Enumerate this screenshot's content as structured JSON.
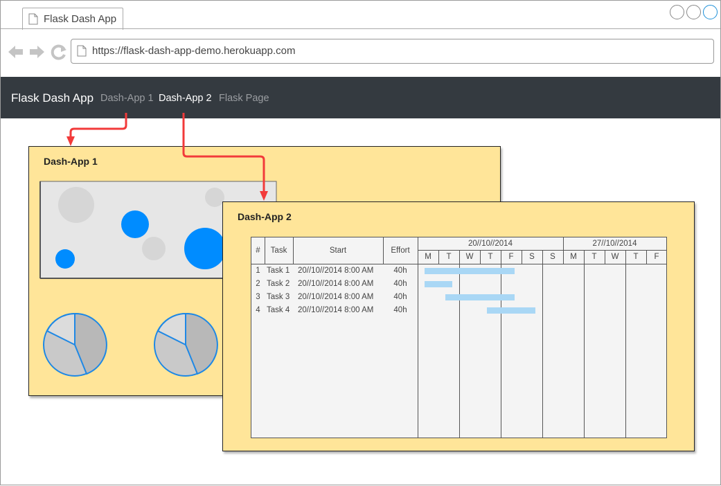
{
  "browser": {
    "tab_title": "Flask Dash App",
    "url": "https://flask-dash-app-demo.herokuapp.com"
  },
  "navbar": {
    "brand": "Flask Dash App",
    "links": [
      "Dash-App 1",
      "Dash-App 2",
      "Flask Page"
    ]
  },
  "panel1": {
    "title": "Dash-App 1"
  },
  "panel2": {
    "title": "Dash-App 2"
  },
  "gantt": {
    "headers": {
      "id": "#",
      "task": "Task",
      "start": "Start",
      "effort": "Effort"
    },
    "weeks": [
      "20//10//2014",
      "27//10//2014"
    ],
    "days": [
      "M",
      "T",
      "W",
      "T",
      "F",
      "S",
      "S",
      "M",
      "T",
      "W",
      "T",
      "F"
    ],
    "rows": [
      {
        "id": "1",
        "task": "Task 1",
        "start": "20//10//2014 8:00 AM",
        "effort": "40h",
        "bar_start_day": 0,
        "bar_days": 4.33
      },
      {
        "id": "2",
        "task": "Task 2",
        "start": "20//10//2014 8:00 AM",
        "effort": "40h",
        "bar_start_day": 0,
        "bar_days": 1.33
      },
      {
        "id": "3",
        "task": "Task 3",
        "start": "20//10//2014 8:00 AM",
        "effort": "40h",
        "bar_start_day": 1,
        "bar_days": 3.33
      },
      {
        "id": "4",
        "task": "Task 4",
        "start": "20//10//2014 8:00 AM",
        "effort": "40h",
        "bar_start_day": 3,
        "bar_days": 2.33
      }
    ]
  },
  "colors": {
    "navbar": "#343a40",
    "panel": "#ffe599",
    "arrow": "#f23a3a",
    "bubble_blue": "#008cff",
    "bubble_gray": "#d6d6d6",
    "gantt_bar": "#a9d7f5"
  }
}
